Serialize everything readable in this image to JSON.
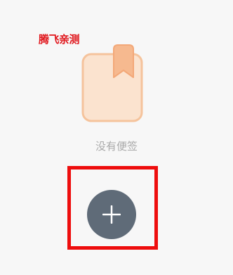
{
  "watermark": {
    "text": "腾飞亲测"
  },
  "empty_state": {
    "icon": "notes-book-icon",
    "message": "没有便签"
  },
  "add_button": {
    "icon": "plus-icon"
  },
  "colors": {
    "background": "#f7f7f7",
    "watermark": "#e0141a",
    "illustration_fill": "#fbe3cf",
    "illustration_stroke": "#f5c39c",
    "bookmark": "#f6b98f",
    "empty_text": "#a9a9a9",
    "highlight_border": "#ee0d0d",
    "add_button": "#5f6b78"
  }
}
